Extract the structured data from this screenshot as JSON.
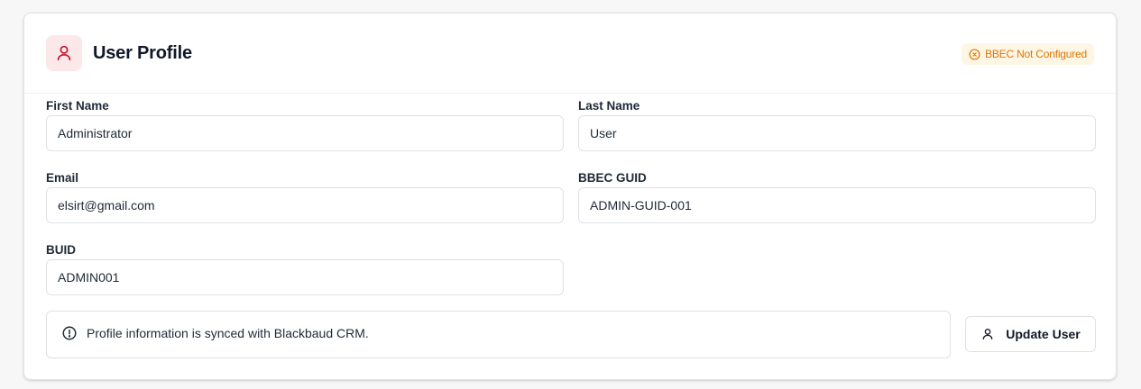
{
  "header": {
    "title": "User Profile",
    "title_icon": "user-icon",
    "status_badge": {
      "label": "BBEC Not Configured",
      "icon": "x-circle-icon",
      "color": "#d97706",
      "background": "#fef6e4"
    }
  },
  "form": {
    "first_name": {
      "label": "First Name",
      "value": "Administrator"
    },
    "last_name": {
      "label": "Last Name",
      "value": "User"
    },
    "email": {
      "label": "Email",
      "value": "elsirt@gmail.com"
    },
    "bbec_guid": {
      "label": "BBEC GUID",
      "value": "ADMIN-GUID-001"
    },
    "buid": {
      "label": "BUID",
      "value": "ADMIN001"
    }
  },
  "info": {
    "icon": "info-circle-icon",
    "text": "Profile information is synced with Blackbaud CRM."
  },
  "actions": {
    "update_label": "Update User",
    "update_icon": "user-icon"
  },
  "colors": {
    "accent": "#c8102e",
    "accent_bg": "#fde8e9",
    "warning": "#d97706"
  }
}
